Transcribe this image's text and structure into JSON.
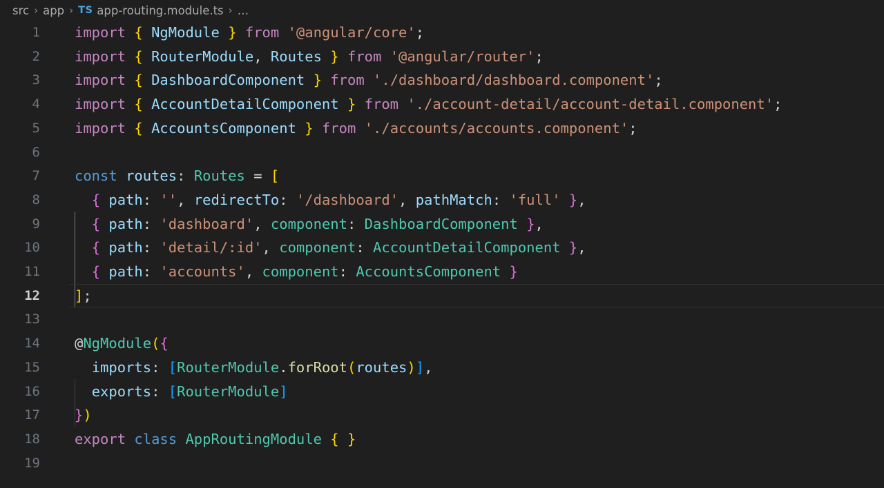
{
  "breadcrumb": {
    "items": [
      "src",
      "app",
      "app-routing.module.ts"
    ],
    "file_icon_label": "TS",
    "separator": "›",
    "overflow": "…"
  },
  "editor": {
    "file_name": "app-routing.module.ts",
    "language": "TypeScript",
    "active_line": 12,
    "total_lines": 19,
    "background_color": "#1f1f1f",
    "line_numbers": [
      1,
      2,
      3,
      4,
      5,
      6,
      7,
      8,
      9,
      10,
      11,
      12,
      13,
      14,
      15,
      16,
      17,
      18,
      19
    ],
    "lines": [
      {
        "n": 1,
        "text": "import { NgModule } from '@angular/core';"
      },
      {
        "n": 2,
        "text": "import { RouterModule, Routes } from '@angular/router';"
      },
      {
        "n": 3,
        "text": "import { DashboardComponent } from './dashboard/dashboard.component';"
      },
      {
        "n": 4,
        "text": "import { AccountDetailComponent } from './account-detail/account-detail.component';"
      },
      {
        "n": 5,
        "text": "import { AccountsComponent } from './accounts/accounts.component';"
      },
      {
        "n": 6,
        "text": ""
      },
      {
        "n": 7,
        "text": "const routes: Routes = ["
      },
      {
        "n": 8,
        "text": "  { path: '', redirectTo: '/dashboard', pathMatch: 'full' },"
      },
      {
        "n": 9,
        "text": "  { path: 'dashboard', component: DashboardComponent },"
      },
      {
        "n": 10,
        "text": "  { path: 'detail/:id', component: AccountDetailComponent },"
      },
      {
        "n": 11,
        "text": "  { path: 'accounts', component: AccountsComponent }"
      },
      {
        "n": 12,
        "text": "];"
      },
      {
        "n": 13,
        "text": ""
      },
      {
        "n": 14,
        "text": "@NgModule({"
      },
      {
        "n": 15,
        "text": "  imports: [RouterModule.forRoot(routes)],"
      },
      {
        "n": 16,
        "text": "  exports: [RouterModule]"
      },
      {
        "n": 17,
        "text": "})"
      },
      {
        "n": 18,
        "text": "export class AppRoutingModule { }"
      },
      {
        "n": 19,
        "text": ""
      }
    ]
  },
  "theme": {
    "keyword": "#c586c0",
    "keyword_control": "#569cd6",
    "class_name": "#4ec9b0",
    "variable": "#9cdcfe",
    "string": "#ce9178",
    "function": "#dcdcaa",
    "punctuation": "#d4d4d4",
    "bracket_level_1": "#ffd700",
    "bracket_level_2": "#da70d6",
    "bracket_level_3": "#179fff",
    "line_number": "#6e7681",
    "line_number_active": "#cfcfcf"
  }
}
